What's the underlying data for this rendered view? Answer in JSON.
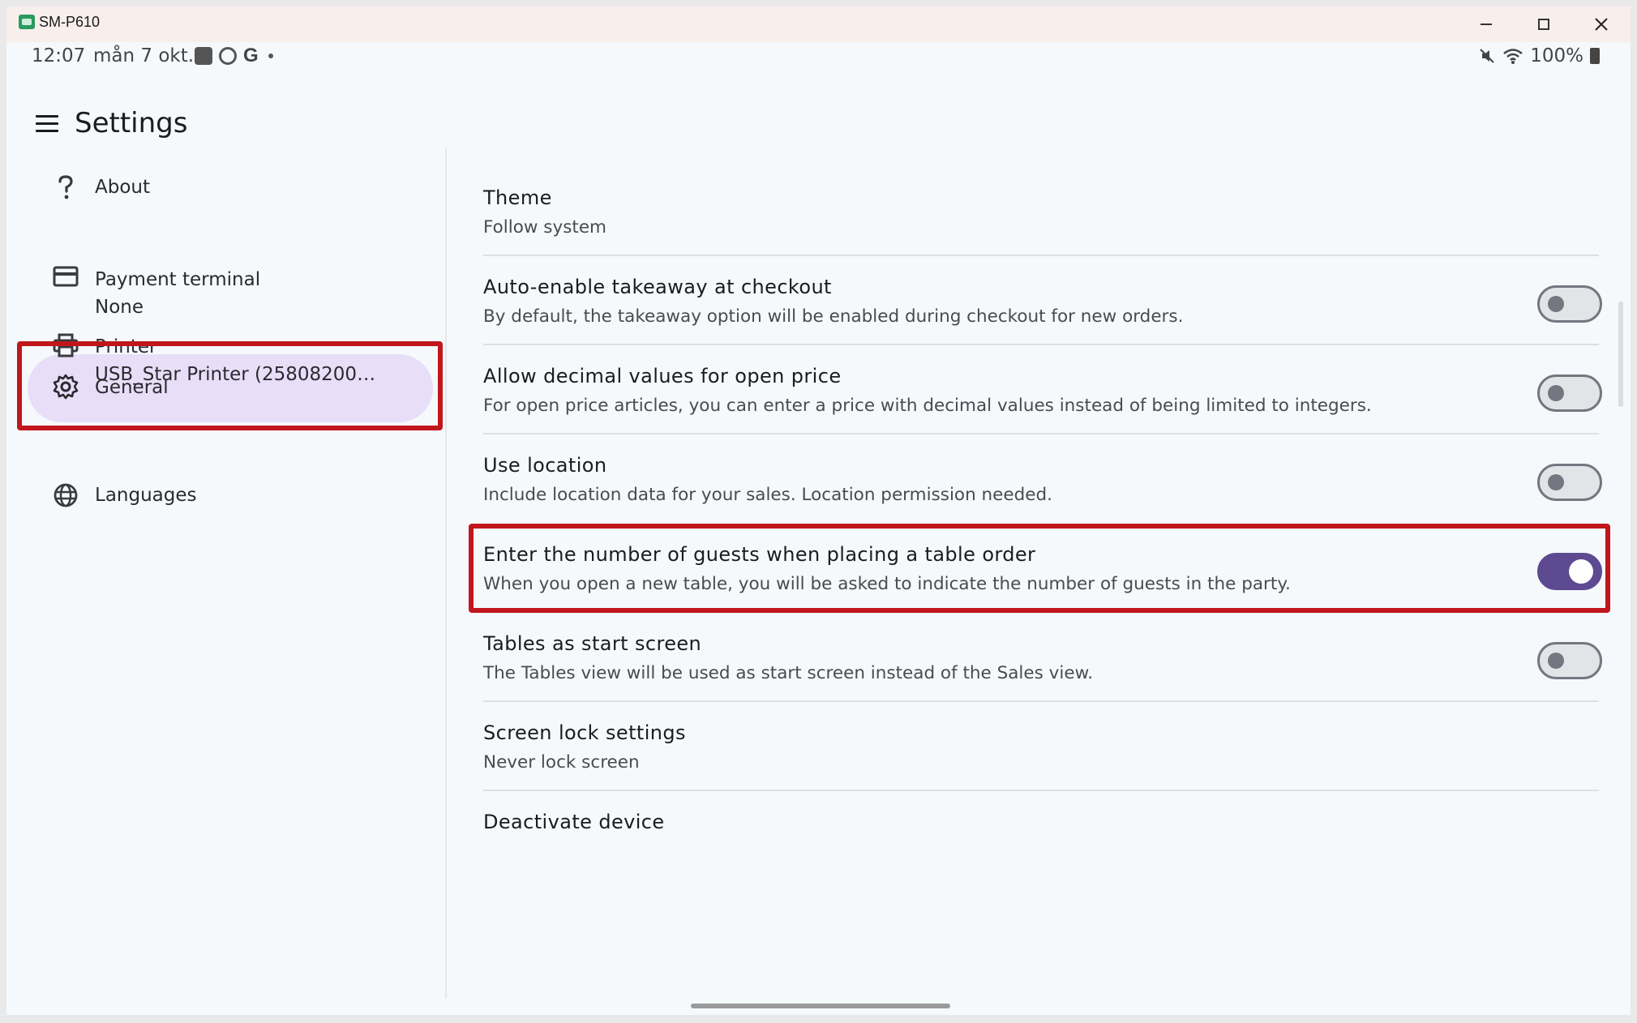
{
  "window": {
    "title": "SM-P610"
  },
  "status_bar": {
    "time": "12:07",
    "date": "mån 7 okt.",
    "google_letter": "G",
    "battery": "100%"
  },
  "header": {
    "title": "Settings"
  },
  "sidebar": {
    "items": [
      {
        "label": "About",
        "icon": "help-icon"
      },
      {
        "label": "Payment terminal",
        "sub": "None",
        "icon": "credit-card-icon"
      },
      {
        "label": "Printer",
        "sub": "USB_Star Printer (25808200906...",
        "icon": "printer-icon"
      },
      {
        "label": "General",
        "icon": "gear-icon",
        "selected": true
      },
      {
        "label": "Languages",
        "icon": "globe-icon"
      }
    ]
  },
  "settings": {
    "theme": {
      "title": "Theme",
      "sub": "Follow system"
    },
    "takeaway": {
      "title": "Auto-enable takeaway at checkout",
      "sub": "By default, the takeaway option will be enabled during checkout for new orders.",
      "enabled": false
    },
    "decimal": {
      "title": "Allow decimal values for open price",
      "sub": "For open price articles, you can enter a price with decimal values instead of being limited to integers.",
      "enabled": false
    },
    "location": {
      "title": "Use location",
      "sub": "Include location data for your sales. Location permission needed.",
      "enabled": false
    },
    "guests": {
      "title": "Enter the number of guests when placing a table order",
      "sub": "When you open a new table, you will be asked to indicate the number of guests in the party.",
      "enabled": true
    },
    "tables_start": {
      "title": "Tables as start screen",
      "sub": "The Tables view will be used as start screen instead of the Sales view.",
      "enabled": false
    },
    "screen_lock": {
      "title": "Screen lock settings",
      "sub": "Never lock screen"
    },
    "deactivate": {
      "title": "Deactivate device"
    }
  },
  "colors": {
    "accent": "#5d4a91",
    "selected_bg": "#e8def8",
    "highlight": "#c0161c",
    "background": "#f5f9fc"
  }
}
